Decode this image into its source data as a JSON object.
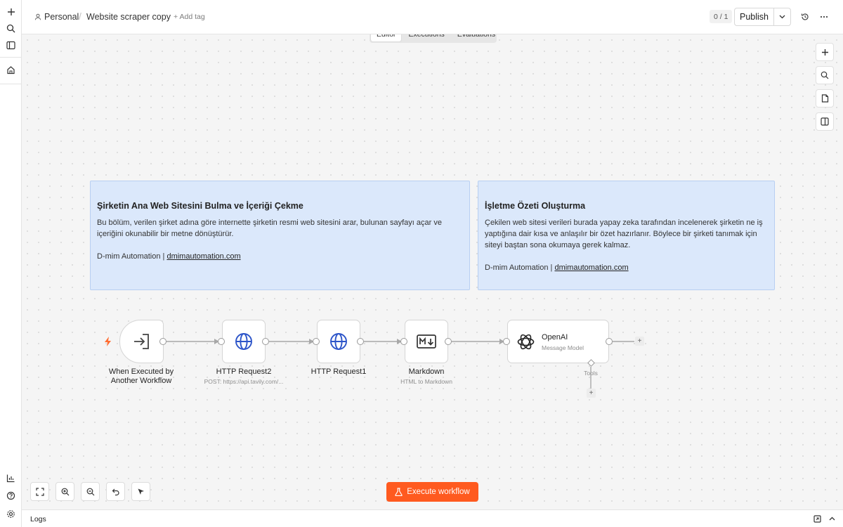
{
  "header": {
    "project": "Personal",
    "separator": "/",
    "workflow_name": "Website scraper copy",
    "add_tag": "+ Add tag",
    "version_count": "0 / 1",
    "publish_label": "Publish"
  },
  "tabs": [
    {
      "label": "Editor",
      "active": true
    },
    {
      "label": "Executions",
      "active": false
    },
    {
      "label": "Evaluations",
      "active": false
    }
  ],
  "notes": [
    {
      "title": "Şirketin Ana Web Sitesini Bulma ve İçeriği Çekme",
      "body": "Bu bölüm, verilen şirket adına göre internette şirketin resmi web sitesini arar, bulunan sayfayı açar ve içeriğini okunabilir bir metne dönüştürür.",
      "credit": "D-mim Automation | ",
      "link": "dmimautomation.com"
    },
    {
      "title": "İşletme Özeti Oluşturma",
      "body": "Çekilen web sitesi verileri burada yapay zeka tarafından incelenerek şirketin ne iş yaptığına dair kısa ve anlaşılır bir özet hazırlanır. Böylece bir şirketi tanımak için siteyi baştan sona okumaya gerek kalmaz.",
      "credit": "D-mim Automation | ",
      "link": "dmimautomation.com"
    }
  ],
  "nodes": {
    "trigger": {
      "label_line1": "When Executed by",
      "label_line2": "Another Workflow"
    },
    "http2": {
      "label": "HTTP Request2",
      "sub": "POST: https://api.tavily.com/..."
    },
    "http1": {
      "label": "HTTP Request1"
    },
    "markdown": {
      "label": "Markdown",
      "sub": "HTML to Markdown"
    },
    "openai": {
      "title": "OpenAI",
      "sub": "Message Model",
      "tools_label": "Tools"
    }
  },
  "execute_label": "Execute workflow",
  "logs_label": "Logs",
  "colors": {
    "accent": "#ff5a1f",
    "note_bg": "#dbe8fb",
    "note_border": "#b8cff2"
  }
}
